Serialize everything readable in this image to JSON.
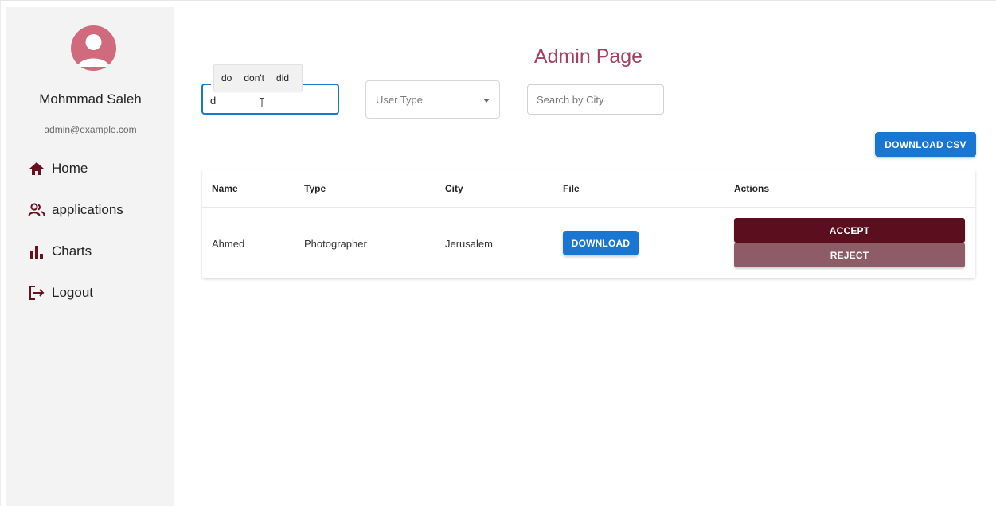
{
  "sidebar": {
    "user_name": "Mohmmad Saleh",
    "user_email": "admin@example.com",
    "items": [
      {
        "label": "Home",
        "icon": "home-icon"
      },
      {
        "label": "applications",
        "icon": "users-icon"
      },
      {
        "label": "Charts",
        "icon": "bar-chart-icon"
      },
      {
        "label": "Logout",
        "icon": "logout-icon"
      }
    ]
  },
  "header": {
    "title": "Admin Page"
  },
  "filters": {
    "name_value": "d",
    "autocomplete": [
      "do",
      "don't",
      "did"
    ],
    "user_type_placeholder": "User Type",
    "city_placeholder": "Search by City"
  },
  "toolbar": {
    "download_csv_label": "DOWNLOAD CSV"
  },
  "table": {
    "columns": [
      "Name",
      "Type",
      "City",
      "File",
      "Actions"
    ],
    "rows": [
      {
        "name": "Ahmed",
        "type": "Photographer",
        "city": "Jerusalem",
        "file_button": "DOWNLOAD",
        "accept_label": "ACCEPT",
        "reject_label": "REJECT"
      }
    ]
  },
  "colors": {
    "accent_blue": "#1976d2",
    "title_color": "#a3415e",
    "accept_bg": "#5b0f1e",
    "reject_bg": "#8e5c67",
    "icon_color": "#6b0f1f",
    "avatar_color": "#d06b7d",
    "sidebar_bg": "#f3f3f4"
  }
}
